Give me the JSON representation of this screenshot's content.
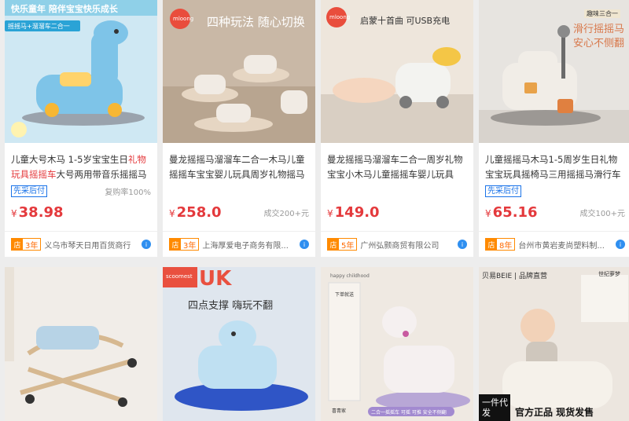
{
  "products": [
    {
      "title_parts": [
        {
          "t": "儿童大号木马 1-5岁宝宝生日",
          "hl": false
        },
        {
          "t": "礼物玩具摇摇车",
          "hl": true
        },
        {
          "t": "大号两用带音乐摇摇马",
          "hl": false
        }
      ],
      "badge": "先采后付",
      "stat": "复购率100%",
      "price": "38.98",
      "years": "3年",
      "shop": "义乌市琴天日用百货商行",
      "overlay": {
        "top": "快乐童年 陪伴宝宝快乐成长",
        "tag": "摇摇马+溜溜车二合一"
      }
    },
    {
      "title_parts": [
        {
          "t": "曼龙摇摇马溜溜车二合一木马儿童摇摇车宝宝婴儿玩具周岁礼物摇马",
          "hl": false
        }
      ],
      "badge": "",
      "stat": "成交200+元",
      "price": "258.0",
      "years": "3年",
      "shop": "上海厚爱电子商务有限...",
      "overlay": {
        "logo": "mloong",
        "top": "四种玩法 随心切换"
      }
    },
    {
      "title_parts": [
        {
          "t": "曼龙摇摇马溜溜车二合一周岁礼物宝宝小木马儿童摇摇车婴儿玩具",
          "hl": false
        }
      ],
      "badge": "",
      "stat": "",
      "price": "149.0",
      "years": "5年",
      "shop": "广州弘颢商贸有限公司",
      "overlay": {
        "logo": "mloong",
        "top": "启蒙十首曲  可USB充电"
      }
    },
    {
      "title_parts": [
        {
          "t": "儿童摇摇马木马1-5周岁生日礼物宝宝玩具摇椅马三用摇摇马滑行车",
          "hl": false
        }
      ],
      "badge": "先采后付",
      "stat": "成交100+元",
      "price": "65.16",
      "years": "8年",
      "shop": "台州市黄岩麦尚塑料制...",
      "overlay": {
        "tag": "趣味三合一",
        "top": "滑行摇摇马",
        "sub": "安心不侧翻"
      }
    },
    {
      "overlay": {}
    },
    {
      "overlay": {
        "logo": "scoomest",
        "big": "UK",
        "top": "四点支撑  嗨玩不翻"
      }
    },
    {
      "overlay": {
        "tag": "happy childhood",
        "side": "下单就送",
        "bottom": "二合一摇摇车 可摇 可推 安全不侧翻",
        "corner": "喜青家"
      }
    },
    {
      "overlay": {
        "logo": "贝易BEIE | 品牌直营",
        "tag": "世纪萝梦",
        "left": "一件代发",
        "right": "官方正品  现货发售"
      }
    }
  ],
  "colors": {
    "price": "#e4393c",
    "badge": "#1a73e8",
    "years": "#ff8a00",
    "bg": "#ededed"
  }
}
